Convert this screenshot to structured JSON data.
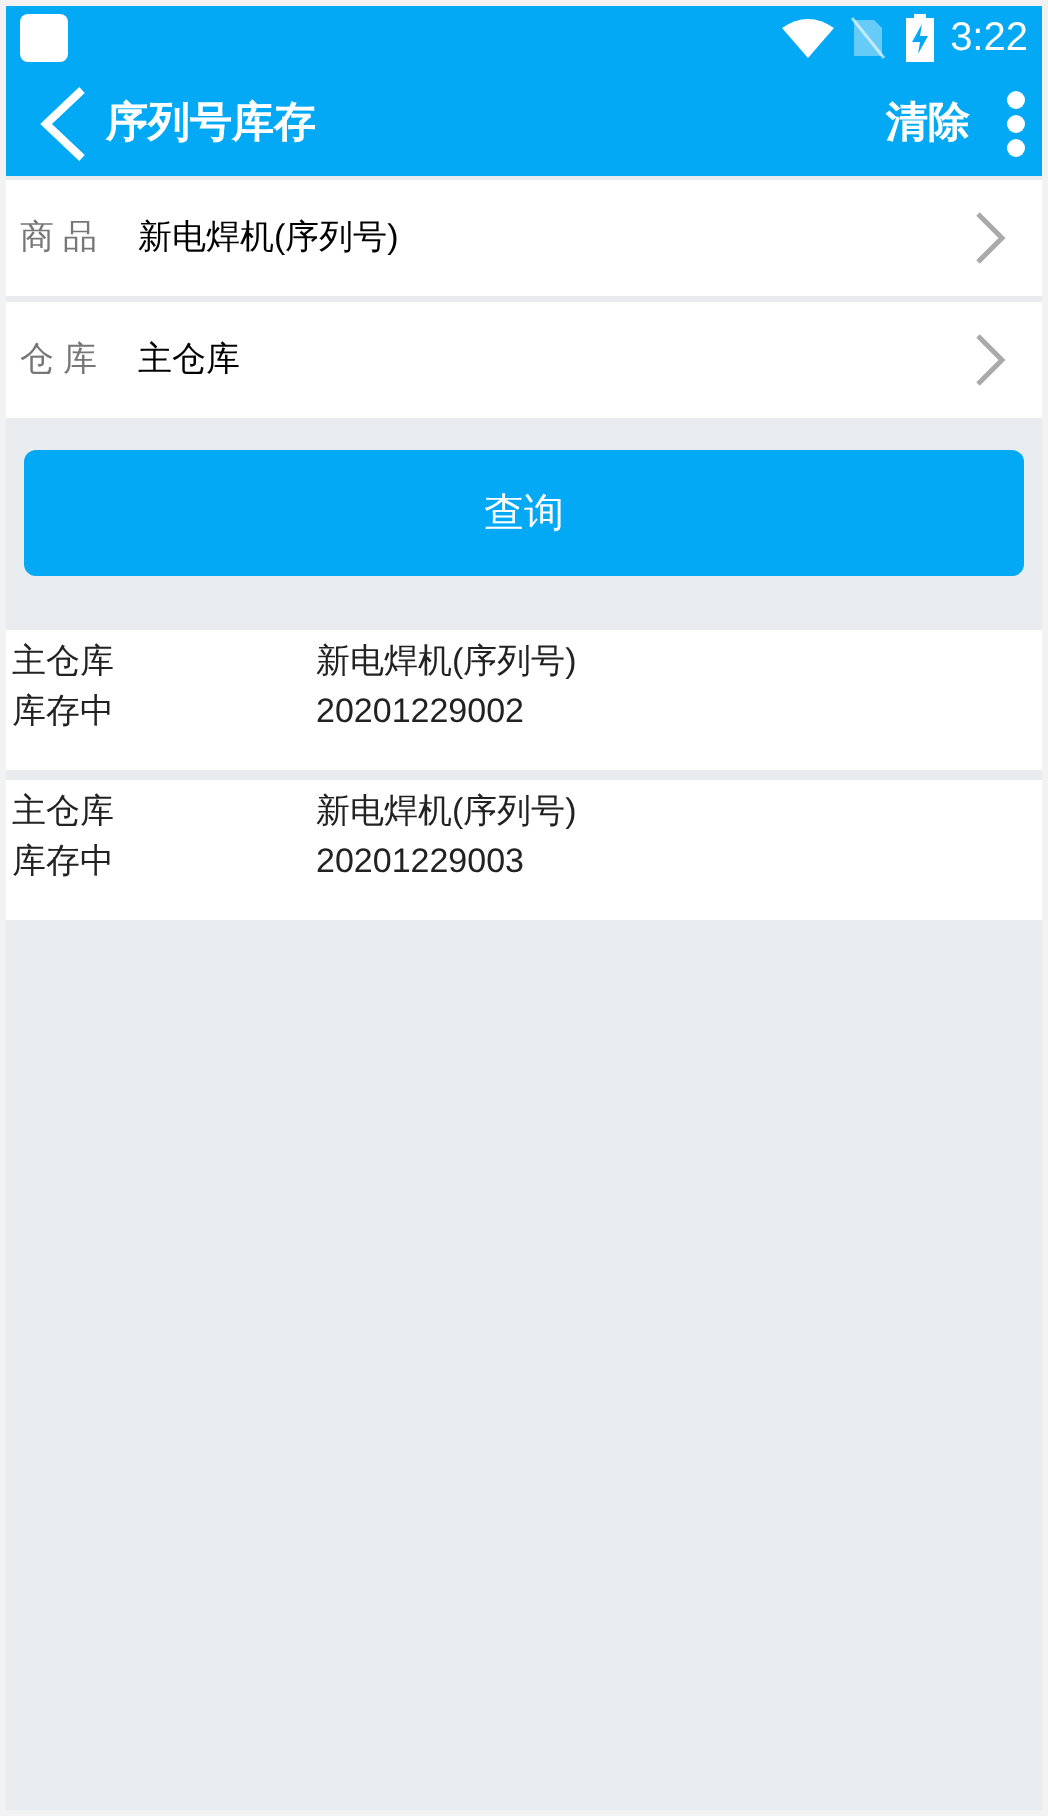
{
  "status_bar": {
    "time": "3:22"
  },
  "toolbar": {
    "title": "序列号库存",
    "action": "清除"
  },
  "form": [
    {
      "label": "商 品",
      "value": "新电焊机(序列号)"
    },
    {
      "label": "仓 库",
      "value": "主仓库"
    }
  ],
  "query_button": "查询",
  "results": [
    {
      "warehouse": "主仓库",
      "status": "库存中",
      "product": "新电焊机(序列号)",
      "serial": "20201229002"
    },
    {
      "warehouse": "主仓库",
      "status": "库存中",
      "product": "新电焊机(序列号)",
      "serial": "20201229003"
    }
  ]
}
